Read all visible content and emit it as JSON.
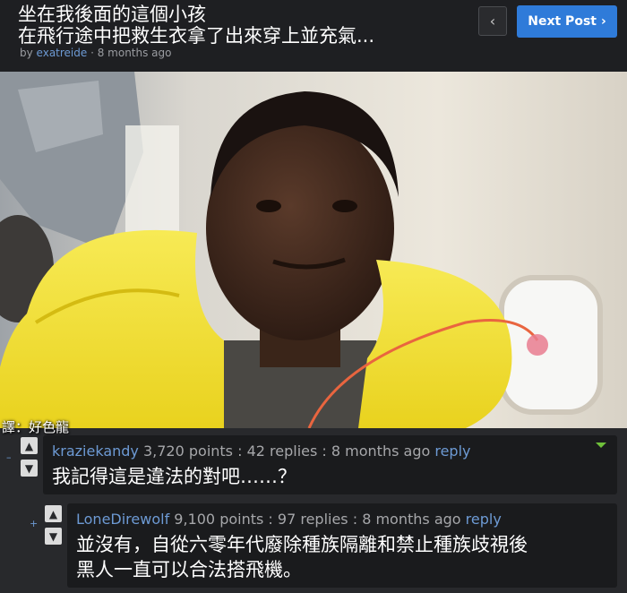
{
  "post": {
    "title_line1": "坐在我後面的這個小孩",
    "title_line2": "在飛行途中把救生衣拿了出來穿上並充氣...",
    "by": "by",
    "author": "exatreide",
    "age": "· 8 months ago"
  },
  "nav": {
    "prev_glyph": "‹",
    "next_label": "Next Post",
    "next_glyph": "›"
  },
  "photo": {
    "translator": "譯：好色龍"
  },
  "comments": [
    {
      "author": "kraziekandy",
      "points": "3,720 points",
      "replies": "42 replies",
      "age": "8 months ago",
      "reply": "reply",
      "collapse": "–",
      "text": "我記得這是違法的對吧……？"
    },
    {
      "author": "LoneDirewolf",
      "points": "9,100 points",
      "replies": "97 replies",
      "age": "8 months ago",
      "reply": "reply",
      "collapse": "+",
      "text_line1": "並沒有，自從六零年代廢除種族隔離和禁止種族歧視後",
      "text_line2": "黑人一直可以合法搭飛機。"
    }
  ],
  "separator": " : ",
  "colors": {
    "accent": "#2f7bd9",
    "link": "#6d9ad4",
    "vest": "#f3e23a"
  }
}
